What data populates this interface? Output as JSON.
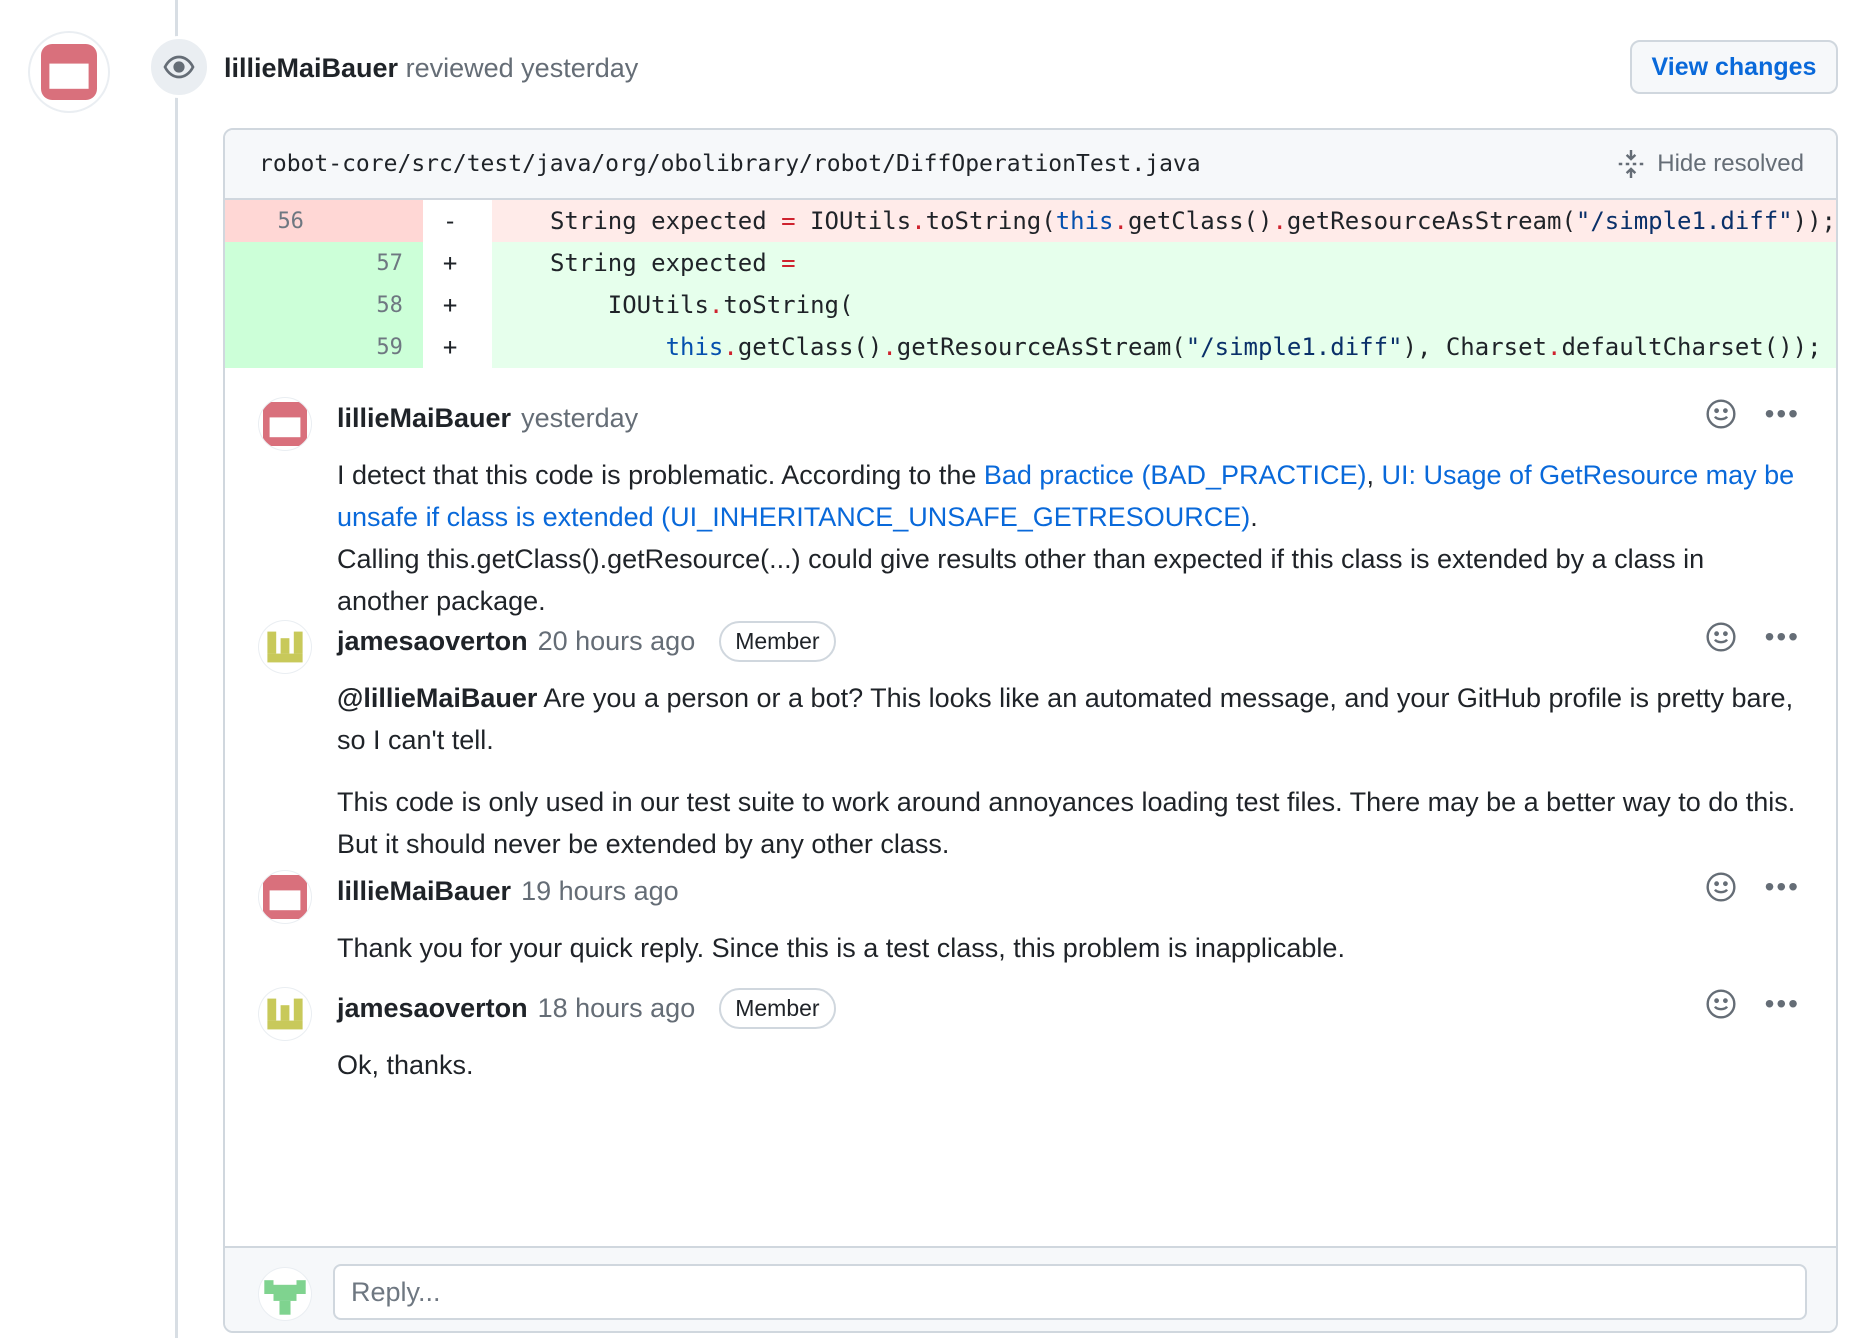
{
  "review": {
    "author": "lillieMaiBauer",
    "action": "reviewed",
    "time": "yesterday",
    "view_changes_label": "View changes"
  },
  "file": {
    "path": "robot-core/src/test/java/org/obolibrary/robot/DiffOperationTest.java",
    "hide_resolved_label": "Hide resolved"
  },
  "diff": [
    {
      "type": "del",
      "old": "56",
      "new": "",
      "sign": "-",
      "indent": "    ",
      "segments": [
        [
          "String expected ",
          ""
        ],
        [
          "=",
          "op"
        ],
        [
          " IOUtils",
          ""
        ],
        [
          ".",
          "op"
        ],
        [
          "toString(",
          ""
        ],
        [
          "this",
          "kw"
        ],
        [
          ".",
          "op"
        ],
        [
          "getClass()",
          ""
        ],
        [
          ".",
          "op"
        ],
        [
          "getResourceAsStream(",
          ""
        ],
        [
          "\"/simple1.diff\"",
          "str"
        ],
        [
          "));",
          ""
        ]
      ]
    },
    {
      "type": "add",
      "old": "",
      "new": "57",
      "sign": "+",
      "indent": "    ",
      "segments": [
        [
          "String expected ",
          ""
        ],
        [
          "=",
          "op"
        ]
      ]
    },
    {
      "type": "add",
      "old": "",
      "new": "58",
      "sign": "+",
      "indent": "        ",
      "segments": [
        [
          "IOUtils",
          ""
        ],
        [
          ".",
          "op"
        ],
        [
          "toString(",
          ""
        ]
      ]
    },
    {
      "type": "add",
      "old": "",
      "new": "59",
      "sign": "+",
      "indent": "            ",
      "segments": [
        [
          "this",
          "kw"
        ],
        [
          ".",
          "op"
        ],
        [
          "getClass()",
          ""
        ],
        [
          ".",
          "op"
        ],
        [
          "getResourceAsStream(",
          ""
        ],
        [
          "\"/simple1.diff\"",
          "str"
        ],
        [
          "), Charset",
          ""
        ],
        [
          ".",
          "op"
        ],
        [
          "defaultCharset());",
          ""
        ]
      ]
    }
  ],
  "comments": [
    {
      "author": "lillieMaiBauer",
      "time": "yesterday",
      "badge": "",
      "paragraphs": [
        [
          [
            "I detect that this code is problematic. According to the ",
            ""
          ],
          [
            "Bad practice (BAD_PRACTICE)",
            "link"
          ],
          [
            ", ",
            ""
          ],
          [
            "UI: Usage of GetResource may be unsafe if class is extended (UI_INHERITANCE_UNSAFE_GETRESOURCE)",
            "link"
          ],
          [
            ".",
            ""
          ]
        ],
        [
          [
            "Calling this.getClass().getResource(...) could give results other than expected if this class is extended by a class in another package.",
            ""
          ]
        ]
      ]
    },
    {
      "author": "jamesaoverton",
      "time": "20 hours ago",
      "badge": "Member",
      "paragraphs": [
        [
          [
            "@lillieMaiBauer",
            "mention"
          ],
          [
            " Are you a person or a bot? This looks like an automated message, and your GitHub profile is pretty bare, so I can't tell.",
            ""
          ]
        ],
        [
          [
            "This code is only used in our test suite to work around annoyances loading test files. There may be a better way to do this. But it should never be extended by any other class.",
            ""
          ]
        ]
      ]
    },
    {
      "author": "lillieMaiBauer",
      "time": "19 hours ago",
      "badge": "",
      "paragraphs": [
        [
          [
            "Thank you for your quick reply. Since this is a test class, this problem is inapplicable.",
            ""
          ]
        ]
      ]
    },
    {
      "author": "jamesaoverton",
      "time": "18 hours ago",
      "badge": "Member",
      "paragraphs": [
        [
          [
            "Ok, thanks.",
            ""
          ]
        ]
      ]
    }
  ],
  "reply": {
    "placeholder": "Reply..."
  },
  "colors": {
    "lillie_avatar": "#d9707c",
    "james_avatar": "#c8c95a",
    "me_avatar": "#7fd38f",
    "link": "#0969da"
  }
}
